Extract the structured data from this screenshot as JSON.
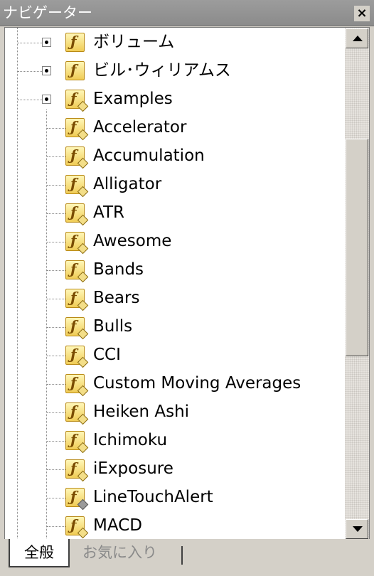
{
  "window": {
    "title": "ナビゲーター",
    "close_glyph": "×"
  },
  "tree": {
    "folders": [
      {
        "label": "ボリューム",
        "icon": "function-folder-icon"
      },
      {
        "label": "ビル･ウィリアムス",
        "icon": "function-folder-icon"
      },
      {
        "label": "Examples",
        "icon": "function-subfolder-icon"
      }
    ],
    "items": [
      {
        "label": "Accelerator"
      },
      {
        "label": "Accumulation"
      },
      {
        "label": "Alligator"
      },
      {
        "label": "ATR"
      },
      {
        "label": "Awesome"
      },
      {
        "label": "Bands"
      },
      {
        "label": "Bears"
      },
      {
        "label": "Bulls"
      },
      {
        "label": "CCI"
      },
      {
        "label": "Custom Moving Averages"
      },
      {
        "label": "Heiken Ashi"
      },
      {
        "label": "Ichimoku"
      },
      {
        "label": "iExposure"
      },
      {
        "label": "LineTouchAlert"
      },
      {
        "label": "MACD"
      }
    ]
  },
  "tabs": [
    {
      "label": "全般",
      "active": true
    },
    {
      "label": "お気に入り",
      "active": false
    }
  ],
  "colors": {
    "titlebar": "#8e8e8e",
    "chrome": "#d4d0c8",
    "tree_bg": "#ffffff",
    "icon_fill": "#f4d96a",
    "icon_border": "#b98a16"
  }
}
